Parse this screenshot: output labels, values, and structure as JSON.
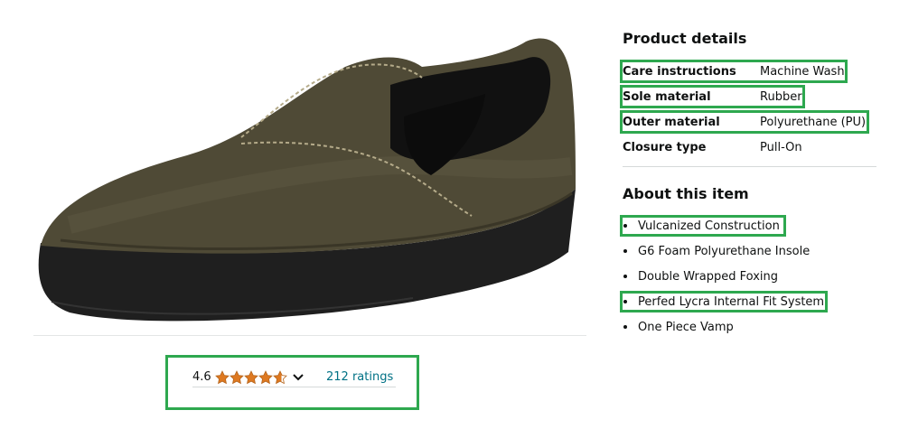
{
  "rating": {
    "value": "4.6",
    "stars": 4.6,
    "ratings_link": "212 ratings",
    "star_color": "#de7921"
  },
  "product_details": {
    "title": "Product details",
    "rows": [
      {
        "label": "Care instructions",
        "value": "Machine Wash"
      },
      {
        "label": "Sole material",
        "value": "Rubber"
      },
      {
        "label": "Outer material",
        "value": "Polyurethane (PU)"
      },
      {
        "label": "Closure type",
        "value": "Pull-On"
      }
    ]
  },
  "about": {
    "title": "About this item",
    "items": [
      "Vulcanized Construction",
      "G6 Foam Polyurethane Insole",
      "Double Wrapped Foxing",
      "Perfed Lycra Internal Fit System",
      "One Piece Vamp"
    ]
  },
  "colors": {
    "highlight": "#2ea84f",
    "link": "#007185",
    "shoe_upper": "#4f4a36",
    "shoe_sole": "#1f1f1f"
  }
}
